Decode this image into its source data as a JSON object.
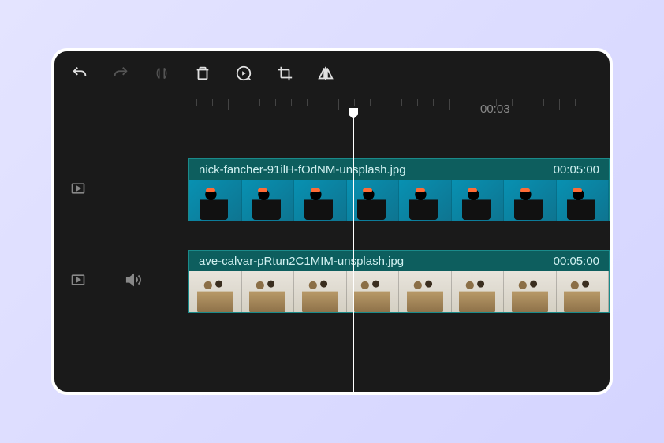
{
  "ruler": {
    "time_label": "00:03"
  },
  "tracks": {
    "clip1": {
      "filename": "nick-fancher-91ilH-fOdNM-unsplash.jpg",
      "duration": "00:05:00"
    },
    "clip2": {
      "filename": "ave-calvar-pRtun2C1MIM-unsplash.jpg",
      "duration": "00:05:00"
    }
  }
}
